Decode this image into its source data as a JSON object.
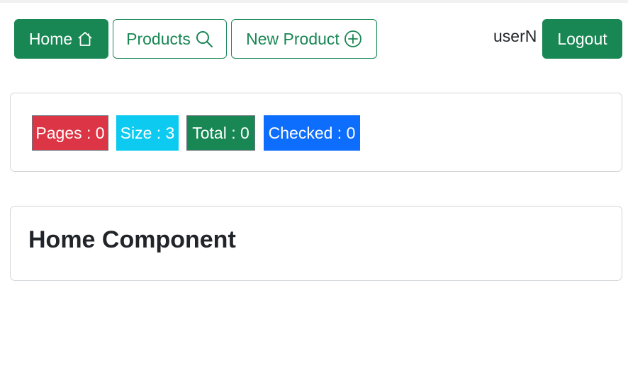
{
  "nav": {
    "home_label": "Home",
    "products_label": "Products",
    "new_product_label": "New Product",
    "username": "userN",
    "logout_label": "Logout"
  },
  "icons": {
    "home": "house-icon",
    "products": "search-icon",
    "new_product": "plus-circle-icon"
  },
  "stats": {
    "pages": "Pages : 0",
    "size": "Size : 3",
    "total": "Total : 0",
    "checked": "Checked : 0"
  },
  "main": {
    "title": "Home Component"
  },
  "colors": {
    "success": "#198754",
    "danger": "#dc3545",
    "info": "#0dcaf0",
    "primary": "#0d6efd"
  }
}
